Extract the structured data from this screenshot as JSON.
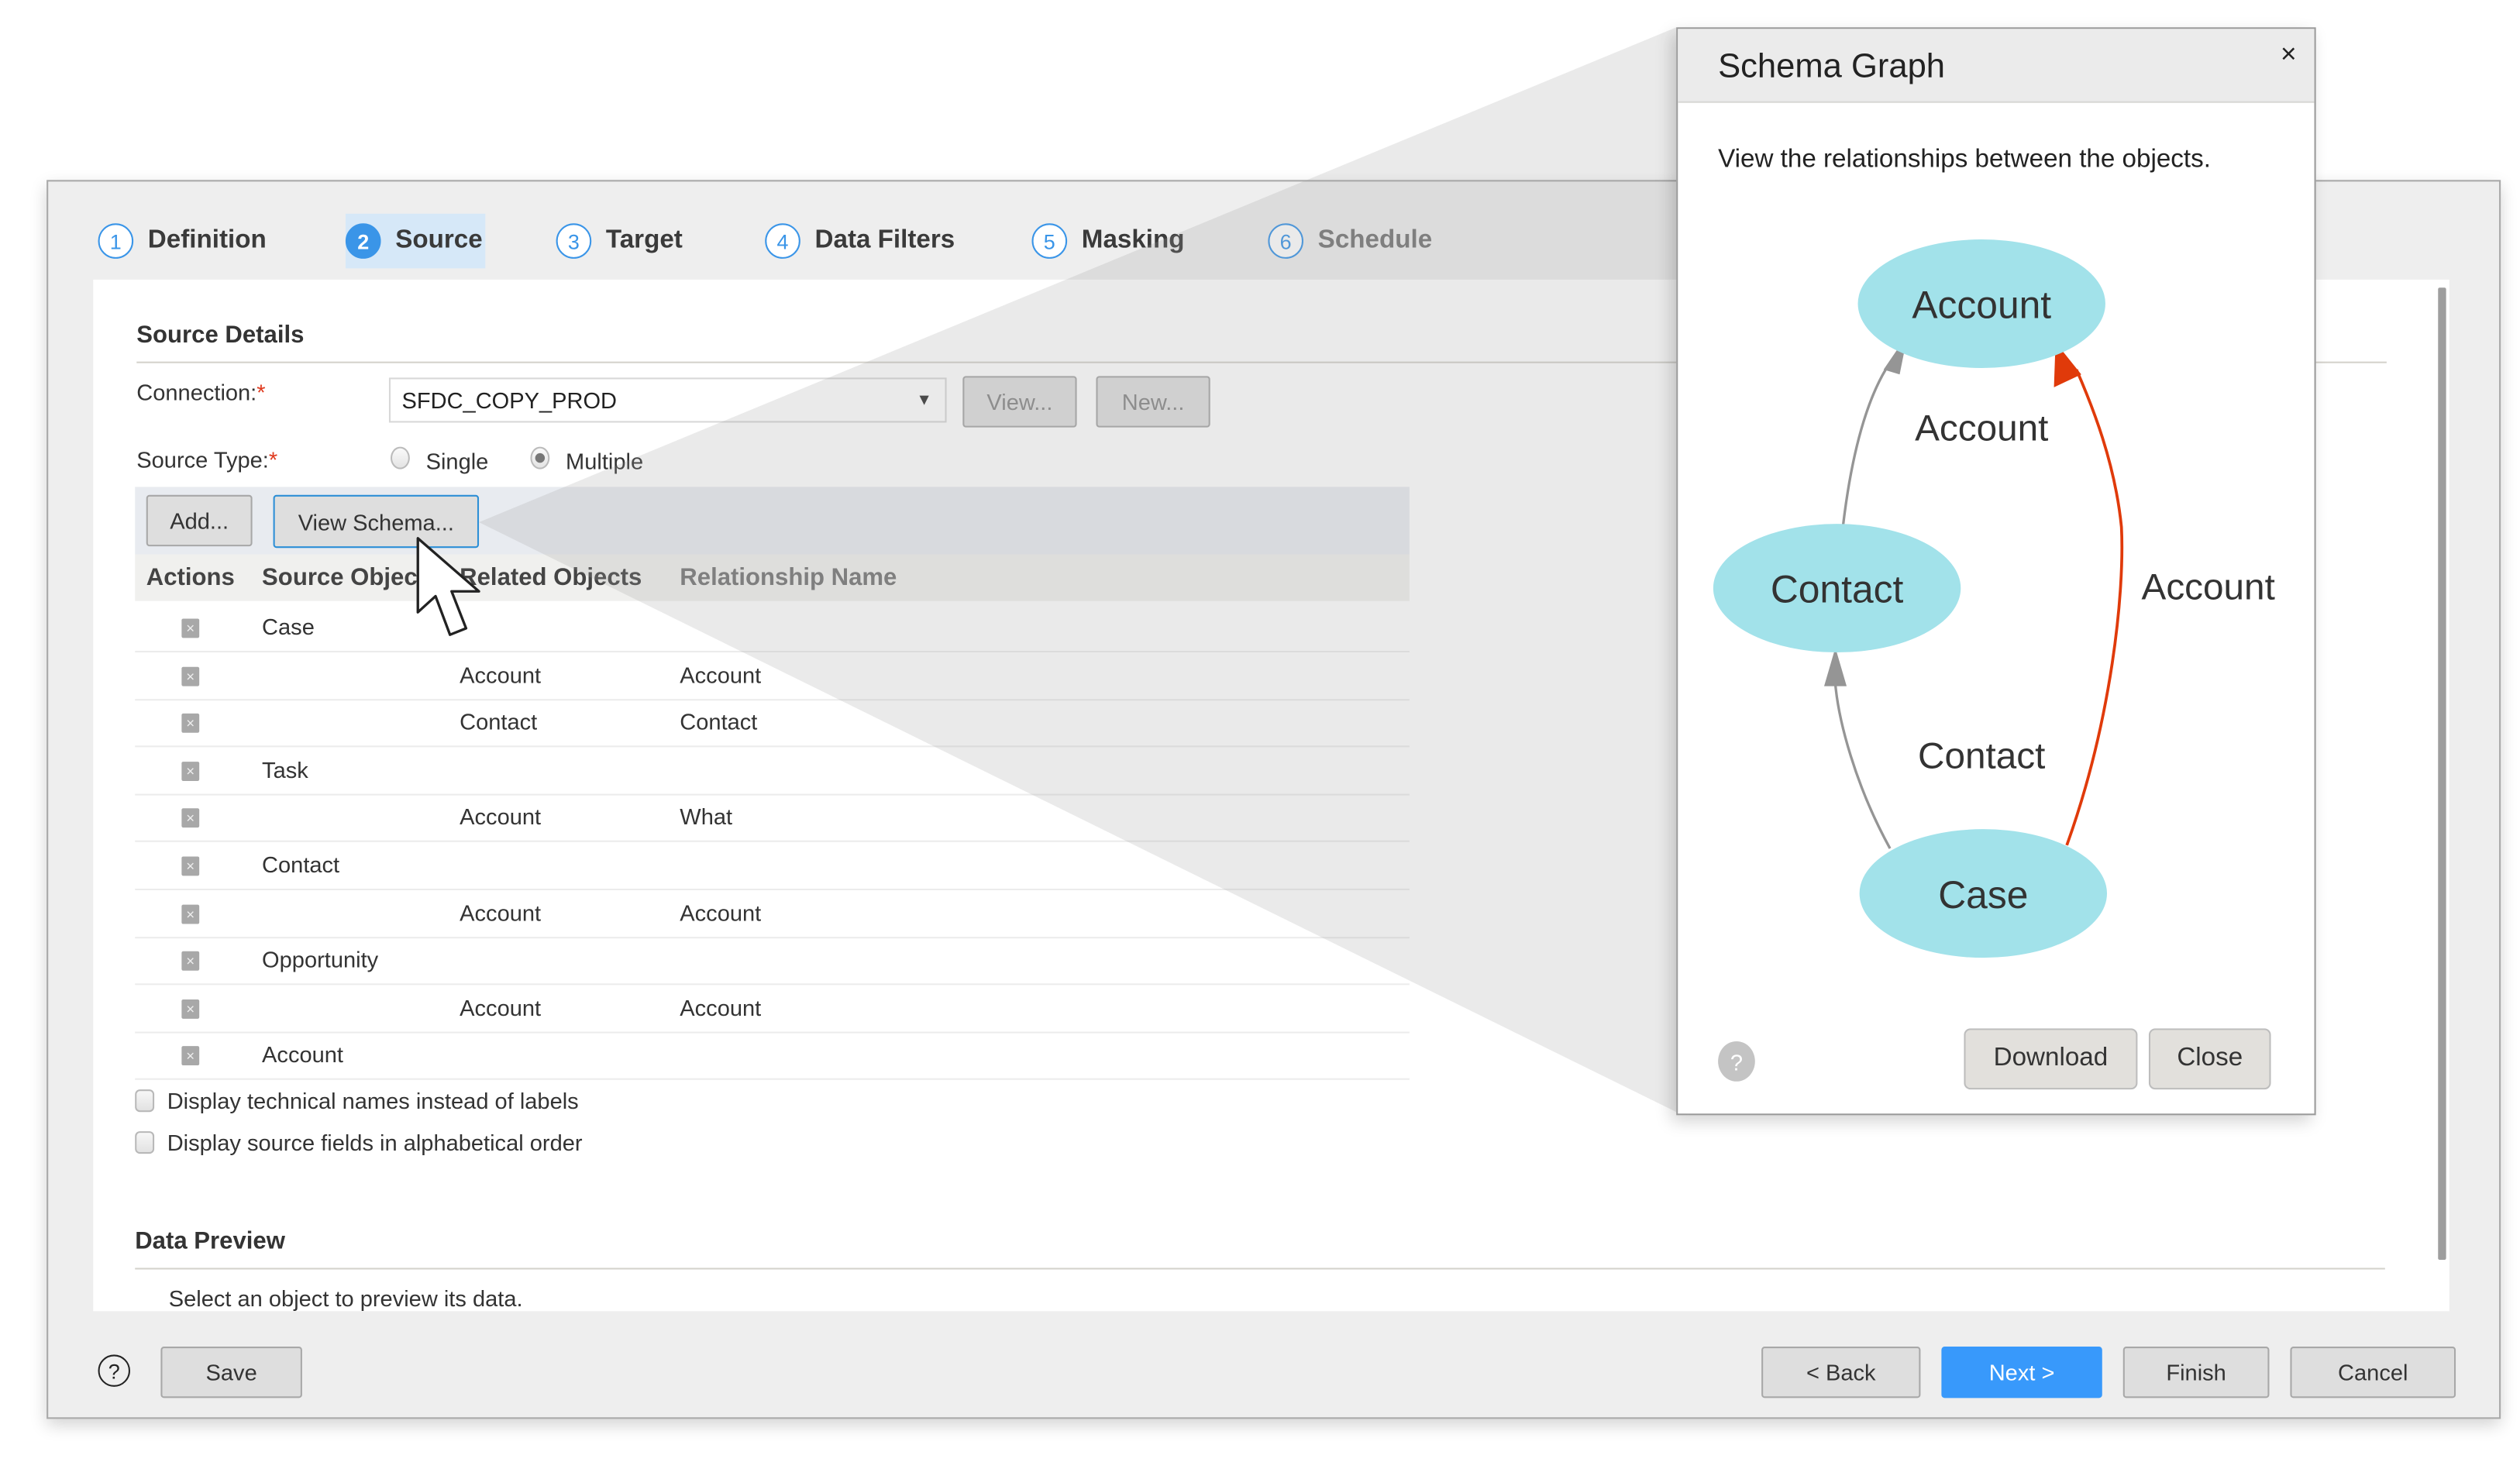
{
  "wizard": {
    "steps": [
      {
        "number": "1",
        "label": "Definition",
        "state": "done"
      },
      {
        "number": "2",
        "label": "Source",
        "state": "active"
      },
      {
        "number": "3",
        "label": "Target",
        "state": "pending"
      },
      {
        "number": "4",
        "label": "Data Filters",
        "state": "pending"
      },
      {
        "number": "5",
        "label": "Masking",
        "state": "pending"
      },
      {
        "number": "6",
        "label": "Schedule",
        "state": "pending"
      }
    ],
    "source_details": {
      "title": "Source Details",
      "connection_label": "Connection:",
      "connection_required": "*",
      "connection_value": "SFDC_COPY_PROD",
      "view_button": "View...",
      "new_button": "New...",
      "source_type_label": "Source Type:",
      "source_type_required": "*",
      "source_type_options": [
        "Single",
        "Multiple"
      ],
      "source_type_selected": "Multiple",
      "add_button": "Add...",
      "view_schema_button": "View Schema..."
    },
    "table": {
      "headers": [
        "Actions",
        "Source Objects",
        "Related Objects",
        "Relationship Name"
      ],
      "rows": [
        {
          "source": "Case",
          "related": "",
          "relationship": ""
        },
        {
          "source": "",
          "related": "Account",
          "relationship": "Account"
        },
        {
          "source": "",
          "related": "Contact",
          "relationship": "Contact"
        },
        {
          "source": "Task",
          "related": "",
          "relationship": ""
        },
        {
          "source": "",
          "related": "Account",
          "relationship": "What"
        },
        {
          "source": "Contact",
          "related": "",
          "relationship": ""
        },
        {
          "source": "",
          "related": "Account",
          "relationship": "Account"
        },
        {
          "source": "Opportunity",
          "related": "",
          "relationship": ""
        },
        {
          "source": "",
          "related": "Account",
          "relationship": "Account"
        },
        {
          "source": "Account",
          "related": "",
          "relationship": ""
        }
      ],
      "remove_icon": "x-icon"
    },
    "options": [
      {
        "label": "Display technical names instead of labels",
        "checked": false
      },
      {
        "label": "Display source fields in alphabetical order",
        "checked": false
      }
    ],
    "data_preview": {
      "title": "Data Preview",
      "message": "Select an object to preview its data."
    },
    "footer": {
      "help_icon": "?",
      "save": "Save",
      "back": "< Back",
      "next": "Next >",
      "finish": "Finish",
      "cancel": "Cancel"
    }
  },
  "dialog": {
    "title": "Schema Graph",
    "close_icon": "×",
    "description": "View the relationships between the objects.",
    "graph": {
      "nodes": [
        {
          "id": "account",
          "label": "Account"
        },
        {
          "id": "contact",
          "label": "Contact"
        },
        {
          "id": "case",
          "label": "Case"
        }
      ],
      "edges": [
        {
          "from": "contact",
          "to": "account",
          "label": "Account",
          "highlighted": false
        },
        {
          "from": "case",
          "to": "contact",
          "label": "Contact",
          "highlighted": false
        },
        {
          "from": "case",
          "to": "account",
          "label": "Account",
          "highlighted": true
        }
      ],
      "node_color": "#a2e2ea",
      "edge_color": "#959595",
      "highlight_color": "#e03a0a"
    },
    "help_icon": "?",
    "download": "Download",
    "close": "Close"
  },
  "colors": {
    "accent": "#3899fb",
    "required": "#e03a1e"
  }
}
